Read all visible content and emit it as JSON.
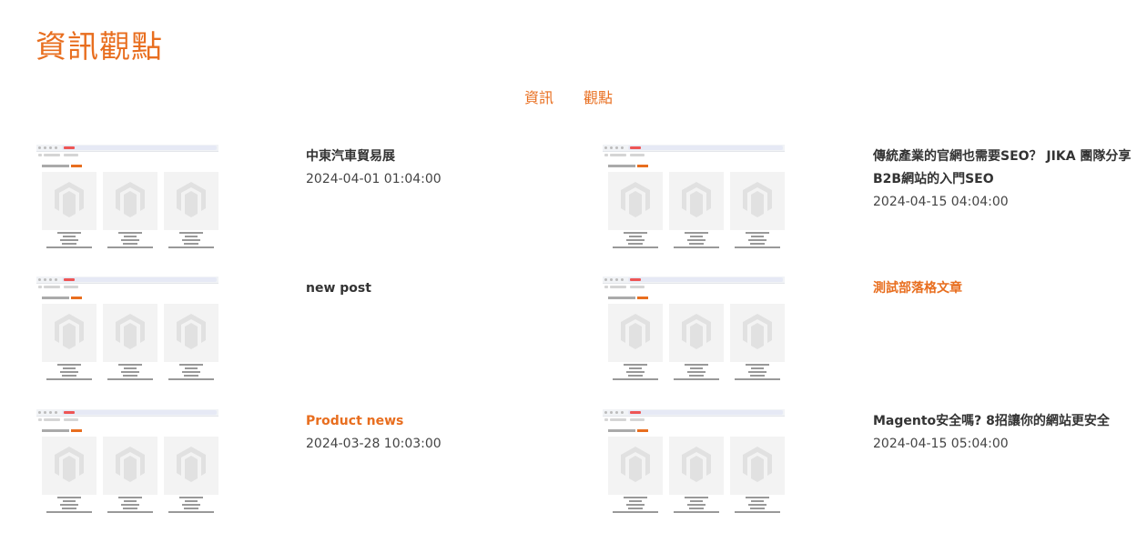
{
  "page": {
    "title": "資訊觀點"
  },
  "tabs": [
    {
      "label": "資訊"
    },
    {
      "label": "觀點"
    }
  ],
  "posts": [
    {
      "title": "中東汽車貿易展",
      "date": "2024-04-01 01:04:00",
      "title_color": "#333333"
    },
    {
      "title": "傳統產業的官網也需要SEO？ JIKA 團隊分享B2B網站的入門SEO",
      "date": "2024-04-15 04:04:00",
      "title_color": "#333333"
    },
    {
      "title": "new post",
      "date": "",
      "title_color": "#333333"
    },
    {
      "title": "測試部落格文章",
      "date": "",
      "title_color": "#e86e1f"
    },
    {
      "title": "Product news",
      "date": "2024-03-28 10:03:00",
      "title_color": "#e86e1f"
    },
    {
      "title": "Magento安全嗎? 8招讓你的網站更安全",
      "date": "2024-04-15 05:04:00",
      "title_color": "#333333"
    }
  ],
  "colors": {
    "accent": "#e86e1f",
    "text": "#333333"
  }
}
